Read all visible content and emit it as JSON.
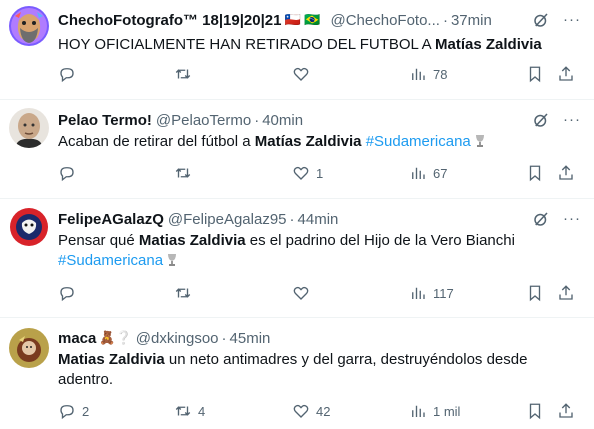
{
  "tweets": [
    {
      "name": "ChechoFotografo™ 18|19|20|21",
      "flags": "🇨🇱 🇧🇷",
      "handle": "@ChechoFoto...",
      "separator": "·",
      "time": "37min",
      "text_pre": "HOY OFICIALMENTE HAN RETIRADO DEL FUTBOL A ",
      "text_bold": "Matías Zaldivia",
      "text_post": "",
      "hashtag": "",
      "replies": "",
      "retweets": "",
      "likes": "",
      "views": "78"
    },
    {
      "name": "Pelao Termo!",
      "handle": "@PelaoTermo",
      "separator": "·",
      "time": "40min",
      "text_pre": "Acaban de retirar del fútbol  a ",
      "text_bold": "Matías Zaldivia",
      "text_post": "",
      "hashtag": "#Sudamericana",
      "replies": "",
      "retweets": "",
      "likes": "1",
      "views": "67"
    },
    {
      "name": "FelipeAGalazQ",
      "handle": "@FelipeAgalaz95",
      "separator": "·",
      "time": "44min",
      "text_pre": "Pensar qué ",
      "text_bold": "Matias Zaldivia",
      "text_post": " es el padrino del Hijo de la Vero Bianchi",
      "hashtag": "#Sudamericana",
      "replies": "",
      "retweets": "",
      "likes": "",
      "views": "117"
    },
    {
      "name": "maca",
      "emoji": "🧸❔",
      "handle": "@dxkingsoo",
      "separator": "·",
      "time": "45min",
      "text_pre": "",
      "text_bold": "Matias Zaldivia",
      "text_post": " un neto antimadres y del garra, destruyéndolos desde adentro.",
      "hashtag": "",
      "replies": "2",
      "retweets": "4",
      "likes": "42",
      "views": "1 mil"
    }
  ],
  "icons": {
    "reply": "reply-icon",
    "retweet": "retweet-icon",
    "like": "heart-icon",
    "views": "views-icon",
    "bookmark": "bookmark-icon",
    "share": "share-icon",
    "grok": "grok-icon",
    "more": "more-icon"
  },
  "colors": {
    "text": "#0f1419",
    "secondary": "#536471",
    "link": "#1d9bf0",
    "divider": "#eff3f4"
  }
}
